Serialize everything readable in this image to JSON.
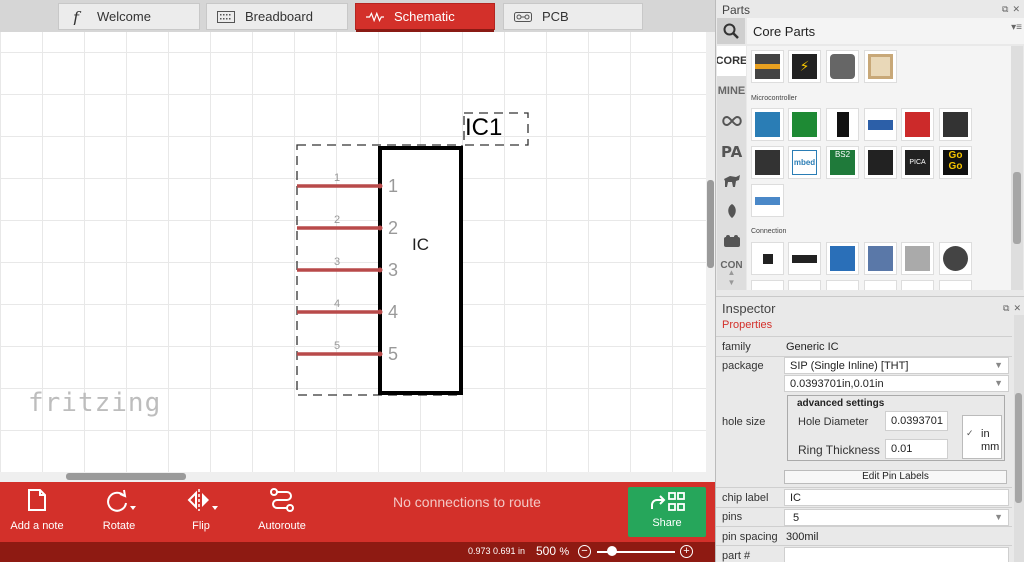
{
  "tabs": [
    {
      "label": "Welcome",
      "icon": "fritzing-f-icon",
      "active": false
    },
    {
      "label": "Breadboard",
      "icon": "breadboard-icon",
      "active": false
    },
    {
      "label": "Schematic",
      "icon": "schematic-icon",
      "active": true
    },
    {
      "label": "PCB",
      "icon": "pcb-icon",
      "active": false
    }
  ],
  "canvas": {
    "part_label": "IC1",
    "chip_text": "IC",
    "pins": [
      {
        "small": "1",
        "big": "1"
      },
      {
        "small": "2",
        "big": "2"
      },
      {
        "small": "3",
        "big": "3"
      },
      {
        "small": "4",
        "big": "4"
      },
      {
        "small": "5",
        "big": "5"
      }
    ],
    "logo": "fritzing"
  },
  "toolbar": {
    "add_note": "Add a note",
    "rotate": "Rotate",
    "flip": "Flip",
    "autoroute": "Autoroute",
    "status": "No connections to route",
    "share": "Share"
  },
  "statusbar": {
    "coords": "0.973 0.691 in",
    "zoom_value": "500",
    "zoom_unit": "%",
    "zoom_minus": "−",
    "zoom_plus": "+"
  },
  "parts": {
    "title": "Parts",
    "bin_title": "Core Parts",
    "bin_tabs": [
      "CORE",
      "MINE",
      "CON"
    ],
    "categories": {
      "microcontroller": "Microcontroller",
      "connection": "Connection"
    }
  },
  "inspector": {
    "title": "Inspector",
    "subtitle": "Properties",
    "family_label": "family",
    "family_value": "Generic IC",
    "package_label": "package",
    "package_value": "SIP (Single Inline) [THT]",
    "hole_value": "0.0393701in,0.01in",
    "hole_size_label": "hole size",
    "advanced_label": "advanced settings",
    "hole_diameter_label": "Hole Diameter",
    "hole_diameter_value": "0.0393701",
    "ring_thickness_label": "Ring Thickness",
    "ring_thickness_value": "0.01",
    "unit_in": "in",
    "unit_mm": "mm",
    "edit_pin_labels": "Edit Pin Labels",
    "chip_label_label": "chip label",
    "chip_label_value": "IC",
    "pins_label": "pins",
    "pins_value": "5",
    "pin_spacing_label": "pin spacing",
    "pin_spacing_value": "300mil",
    "part_num_label": "part #",
    "part_num_value": ""
  },
  "colors": {
    "accent_red": "#d3302a",
    "dark_red": "#8e1a12",
    "share_green": "#26a65b",
    "pin_wire": "#b84a4a"
  }
}
